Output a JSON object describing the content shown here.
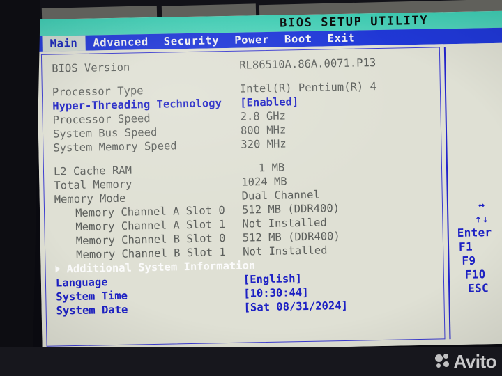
{
  "title": "BIOS SETUP UTILITY",
  "menu": [
    {
      "label": "Main",
      "active": true
    },
    {
      "label": "Advanced",
      "active": false
    },
    {
      "label": "Security",
      "active": false
    },
    {
      "label": "Power",
      "active": false
    },
    {
      "label": "Boot",
      "active": false
    },
    {
      "label": "Exit",
      "active": false
    }
  ],
  "rows": {
    "bios_version_label": "BIOS Version",
    "bios_version_value": "RL86510A.86A.0071.P13",
    "processor_type_label": "Processor Type",
    "processor_type_value": "Intel(R)  Pentium(R)  4",
    "hyper_threading_label": "Hyper-Threading Technology",
    "hyper_threading_value": "[Enabled]",
    "processor_speed_label": "Processor Speed",
    "processor_speed_value": "2.8 GHz",
    "system_bus_speed_label": "System Bus Speed",
    "system_bus_speed_value": "800 MHz",
    "system_memory_speed_label": "System Memory Speed",
    "system_memory_speed_value": "320 MHz",
    "l2_cache_label": "L2 Cache RAM",
    "l2_cache_value": "1 MB",
    "total_memory_label": "Total Memory",
    "total_memory_value": "1024 MB",
    "memory_mode_label": "Memory Mode",
    "memory_mode_value": "Dual Channel",
    "mem_a0_label": "Memory Channel A Slot 0",
    "mem_a0_value": "512 MB (DDR400)",
    "mem_a1_label": "Memory Channel A Slot 1",
    "mem_a1_value": "Not Installed",
    "mem_b0_label": "Memory Channel B Slot 0",
    "mem_b0_value": "512 MB (DDR400)",
    "mem_b1_label": "Memory Channel B Slot 1",
    "mem_b1_value": "Not Installed",
    "additional_info_label": "Additional System Information",
    "language_label": "Language",
    "language_value": "[English]",
    "system_time_label": "System Time",
    "system_time_value": "[10:30:44]",
    "system_date_label": "System Date",
    "system_date_value": "[Sat 08/31/2024]"
  },
  "keys": [
    {
      "name": "left-right-arrows",
      "glyph": "↔"
    },
    {
      "name": "up-down-arrows",
      "glyph": "↑↓"
    },
    {
      "name": "enter-key",
      "glyph": "Enter"
    },
    {
      "name": "f1-key",
      "glyph": "F1"
    },
    {
      "name": "f9-key",
      "glyph": "F9"
    },
    {
      "name": "f10-key",
      "glyph": "F10"
    },
    {
      "name": "esc-key",
      "glyph": "ESC"
    }
  ],
  "watermark": {
    "text": "Avito"
  },
  "colors": {
    "titlebar": "#44cfb4",
    "menubar": "#2038d8",
    "screen_bg": "#dfe0d4",
    "accent_blue": "#1d21c4",
    "label_gray": "#5c5f5c",
    "highlight_white": "#fbfbfb"
  }
}
